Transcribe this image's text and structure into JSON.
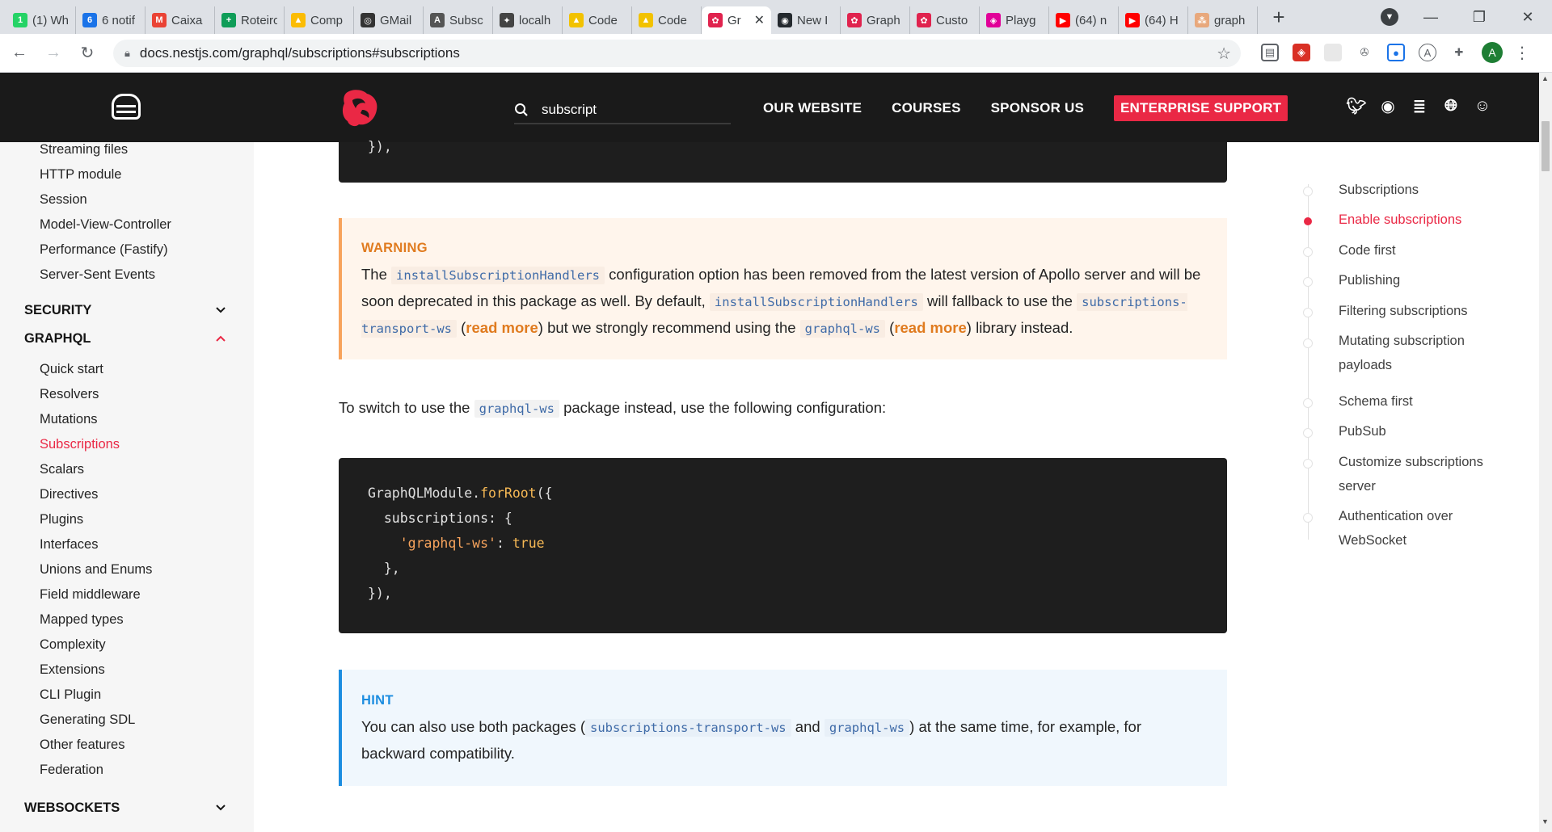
{
  "browser": {
    "tabs": [
      {
        "label": "(1) Wh",
        "fav": "1",
        "color": "#25d366"
      },
      {
        "label": "6 notif",
        "fav": "6",
        "color": "#1a73e8"
      },
      {
        "label": "Caixa",
        "fav": "M",
        "color": "#ea4335"
      },
      {
        "label": "Roteiro",
        "fav": "+",
        "color": "#0f9d58"
      },
      {
        "label": "Comp",
        "fav": "▲",
        "color": "#fbbc04"
      },
      {
        "label": "GMail",
        "fav": "◎",
        "color": "#333333"
      },
      {
        "label": "Subsc",
        "fav": "A",
        "color": "#555555"
      },
      {
        "label": "localh",
        "fav": "✦",
        "color": "#444444"
      },
      {
        "label": "Code",
        "fav": "▲",
        "color": "#f2c200"
      },
      {
        "label": "Code",
        "fav": "▲",
        "color": "#f2c200"
      },
      {
        "label": "Gr",
        "fav": "✿",
        "color": "#e0234e",
        "active": true
      },
      {
        "label": "New I",
        "fav": "◉",
        "color": "#24292e"
      },
      {
        "label": "Graph",
        "fav": "✿",
        "color": "#e0234e"
      },
      {
        "label": "Custo",
        "fav": "✿",
        "color": "#e0234e"
      },
      {
        "label": "Playg",
        "fav": "◈",
        "color": "#e10098"
      },
      {
        "label": "(64) n",
        "fav": "▶",
        "color": "#ff0000"
      },
      {
        "label": "(64) H",
        "fav": "▶",
        "color": "#ff0000"
      },
      {
        "label": "graph",
        "fav": "⁂",
        "color": "#e8a87c"
      }
    ],
    "url": "docs.nestjs.com/graphql/subscriptions#subscriptions",
    "avatar_letter": "A"
  },
  "header": {
    "search_value": "subscript",
    "nav": [
      "OUR WEBSITE",
      "COURSES",
      "SPONSOR US",
      "ENTERPRISE SUPPORT"
    ]
  },
  "sidebar": {
    "items_top": [
      "Streaming files",
      "HTTP module",
      "Session",
      "Model-View-Controller",
      "Performance (Fastify)",
      "Server-Sent Events"
    ],
    "group_security": "SECURITY",
    "group_graphql": "GRAPHQL",
    "graphql_items": [
      "Quick start",
      "Resolvers",
      "Mutations",
      "Subscriptions",
      "Scalars",
      "Directives",
      "Plugins",
      "Interfaces",
      "Unions and Enums",
      "Field middleware",
      "Mapped types",
      "Complexity",
      "Extensions",
      "CLI Plugin",
      "Generating SDL",
      "Other features",
      "Federation"
    ],
    "group_websockets": "WEBSOCKETS"
  },
  "content": {
    "top_code_tail": "}),",
    "warning": {
      "title": "WARNING",
      "t1": "The ",
      "c1": "installSubscriptionHandlers",
      "t2": " configuration option has been removed from the latest version of Apollo server and will be soon deprecated in this package as well. By default, ",
      "c2": "installSubscriptionHandlers",
      "t3": " will fallback to use the ",
      "c3": "subscriptions-transport-ws",
      "t4": " (",
      "l1": "read more",
      "t5": ") but we strongly recommend using the ",
      "c4": "graphql-ws",
      "t6": " (",
      "l2": "read more",
      "t7": ") library instead."
    },
    "para": {
      "t1": "To switch to use the ",
      "c1": "graphql-ws",
      "t2": " package instead, use the following configuration:"
    },
    "code": {
      "l1a": "GraphQLModule",
      "l1b": ".",
      "l1c": "forRoot",
      "l1d": "({",
      "l2a": "  subscriptions",
      "l2b": ": {",
      "l3a": "    'graphql-ws'",
      "l3b": ": ",
      "l3c": "true",
      "l4": "  },",
      "l5": "}),"
    },
    "hint": {
      "title": "HINT",
      "t1": "You can also use both packages (",
      "c1": "subscriptions-transport-ws",
      "t2": " and ",
      "c2": "graphql-ws",
      "t3": ") at the same time, for example, for backward compatibility."
    }
  },
  "toc": {
    "items": [
      "Subscriptions",
      "Enable subscriptions",
      "Code first",
      "Publishing",
      "Filtering subscriptions",
      "Mutating subscription payloads",
      "Schema first",
      "PubSub",
      "Customize subscriptions server",
      "Authentication over WebSocket"
    ],
    "active_index": 1
  },
  "colors": {
    "brand": "#ea2845",
    "warning": "#f7a35c",
    "hint": "#1c8de0"
  }
}
